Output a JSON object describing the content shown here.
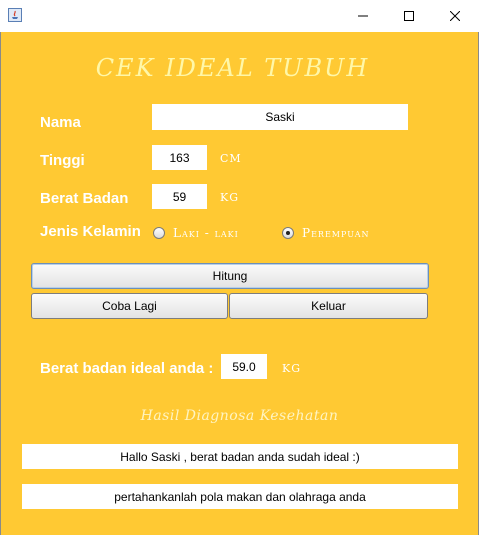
{
  "window": {
    "title": "",
    "minimize_icon": "minimize-icon",
    "maximize_icon": "maximize-icon",
    "close_icon": "close-icon"
  },
  "form": {
    "heading": "CEK IDEAL TUBUH",
    "nama_label": "Nama",
    "nama_value": "Saski",
    "tinggi_label": "Tinggi",
    "tinggi_value": "163",
    "tinggi_unit": "CM",
    "berat_label": "Berat Badan",
    "berat_value": "59",
    "berat_unit": "KG",
    "kelamin_label": "Jenis Kelamin",
    "kelamin_options": [
      {
        "label": "Laki - laki",
        "checked": false
      },
      {
        "label": "Perempuan",
        "checked": true
      }
    ]
  },
  "buttons": {
    "hitung": "Hitung",
    "coba_lagi": "Coba Lagi",
    "keluar": "Keluar"
  },
  "result": {
    "label": "Berat badan ideal anda :",
    "value": "59.0",
    "unit": "KG",
    "diagnosa_title": "Hasil Diagnosa Kesehatan",
    "message_1": "Hallo Saski , berat badan anda sudah ideal :)",
    "message_2": "pertahankanlah pola makan dan olahraga anda"
  },
  "colors": {
    "background": "#ffc933",
    "label_text": "#ffffff",
    "heading_text": "#fff7a8"
  }
}
